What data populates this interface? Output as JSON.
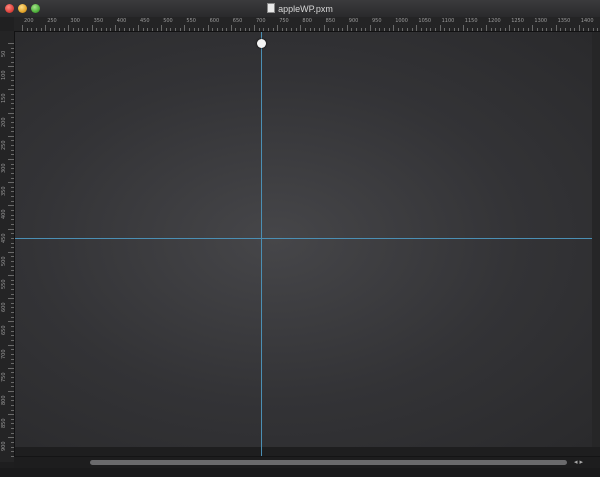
{
  "window": {
    "title": "appleWP.pxm",
    "controls": [
      "close-button",
      "minimize-button",
      "zoom-button"
    ]
  },
  "rulers": {
    "horizontal_labels": [
      "200",
      "250",
      "300",
      "350",
      "400",
      "450",
      "500",
      "550",
      "600",
      "650",
      "700",
      "750",
      "800",
      "850",
      "900",
      "950",
      "1000",
      "1050",
      "1100",
      "1150",
      "1200",
      "1250",
      "1300",
      "1350",
      "1400"
    ],
    "vertical_labels": [
      "50",
      "100",
      "150",
      "200",
      "250",
      "300",
      "350",
      "400",
      "450",
      "500",
      "550",
      "600",
      "650",
      "700",
      "750",
      "800",
      "850",
      "900"
    ]
  },
  "canvas": {
    "guides": [
      "vertical",
      "horizontal"
    ],
    "background_color": "#3a3a3d",
    "guide_color": "#4b8fb4"
  },
  "scroll": {
    "left_arrow": "◂",
    "right_arrow": "▸"
  }
}
